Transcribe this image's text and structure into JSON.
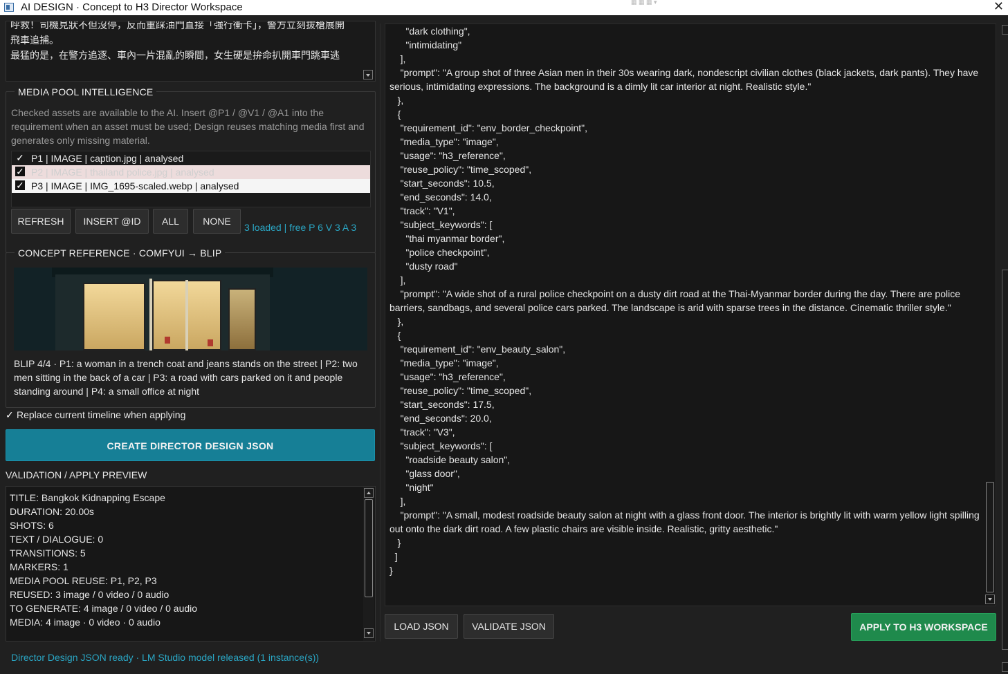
{
  "window": {
    "title": "AI DESIGN · Concept to H3 Director Workspace",
    "close_glyph": "✕"
  },
  "story": {
    "text": "呼救！司機見狀不但沒停，反而重踩油門直接「強行衝卡」，警方立刻拔槍展開\n飛車追捕。\n最猛的是，在警方追逐、車內一片混亂的瞬間，女生硬是拚命扒開車門跳車逃"
  },
  "media_pool": {
    "title": "MEDIA POOL INTELLIGENCE",
    "description": "Checked assets are available to the AI. Insert @P1 / @V1 / @A1 into the requirement when an asset must be used; Design reuses matching media first and generates only missing material.",
    "assets": [
      {
        "check": "✓",
        "label": "P1  |  IMAGE  |  caption.jpg  |  analysed"
      },
      {
        "check": "✓",
        "label": "P2  |  IMAGE  |  thailand police.jpg  |  analysed"
      },
      {
        "check": "✓",
        "label": "P3  |  IMAGE  |  IMG_1695-scaled.webp  |  analysed"
      }
    ],
    "buttons": {
      "refresh": "REFRESH",
      "insert": "INSERT @ID",
      "all": "ALL",
      "none": "NONE"
    },
    "status": "3 loaded  |  free P 6 V 3 A 3"
  },
  "concept": {
    "title": "CONCEPT REFERENCE · COMFYUI → BLIP",
    "caption": "BLIP 4/4 · P1: a woman in a trench coat and jeans stands on the street | P2: two men sitting in the back of a car | P3: a road with cars parked on it and people standing around | P4: a small office at night"
  },
  "options": {
    "replace_tick": "✓",
    "replace_label": "Replace current timeline when applying"
  },
  "actions": {
    "create": "CREATE DIRECTOR DESIGN JSON",
    "load": "LOAD JSON",
    "validate": "VALIDATE JSON",
    "apply": "APPLY TO H3 WORKSPACE"
  },
  "validation": {
    "label": "VALIDATION / APPLY PREVIEW",
    "lines": [
      "TITLE: Bangkok Kidnapping Escape",
      "DURATION: 20.00s",
      "SHOTS: 6",
      "TEXT / DIALOGUE: 0",
      "TRANSITIONS: 5",
      "MARKERS: 1",
      "MEDIA POOL REUSE: P1, P2, P3",
      "REUSED: 3 image / 0 video / 0 audio",
      "TO GENERATE: 4 image / 0 video / 0 audio",
      "MEDIA: 4 image · 0 video · 0 audio"
    ]
  },
  "json_view": {
    "text": "      \"dark clothing\",\n      \"intimidating\"\n    ],\n    \"prompt\": \"A group shot of three Asian men in their 30s wearing dark, nondescript civilian clothes (black jackets, dark pants). They have serious, intimidating expressions. The background is a dimly lit car interior at night. Realistic style.\"\n   },\n   {\n    \"requirement_id\": \"env_border_checkpoint\",\n    \"media_type\": \"image\",\n    \"usage\": \"h3_reference\",\n    \"reuse_policy\": \"time_scoped\",\n    \"start_seconds\": 10.5,\n    \"end_seconds\": 14.0,\n    \"track\": \"V1\",\n    \"subject_keywords\": [\n      \"thai myanmar border\",\n      \"police checkpoint\",\n      \"dusty road\"\n    ],\n    \"prompt\": \"A wide shot of a rural police checkpoint on a dusty dirt road at the Thai-Myanmar border during the day. There are police barriers, sandbags, and several police cars parked. The landscape is arid with sparse trees in the distance. Cinematic thriller style.\"\n   },\n   {\n    \"requirement_id\": \"env_beauty_salon\",\n    \"media_type\": \"image\",\n    \"usage\": \"h3_reference\",\n    \"reuse_policy\": \"time_scoped\",\n    \"start_seconds\": 17.5,\n    \"end_seconds\": 20.0,\n    \"track\": \"V3\",\n    \"subject_keywords\": [\n      \"roadside beauty salon\",\n      \"glass door\",\n      \"night\"\n    ],\n    \"prompt\": \"A small, modest roadside beauty salon at night with a glass front door. The interior is brightly lit with warm yellow light spilling out onto the dark dirt road. A few plastic chairs are visible inside. Realistic, gritty aesthetic.\"\n   }\n  ]\n}"
  },
  "status_bar": {
    "text": "Director Design JSON ready · LM Studio model released (1 instance(s))"
  },
  "colors": {
    "accent_create": "#167f96",
    "accent_apply": "#1f8a4c",
    "status_text": "#2aa6c4",
    "background": "#202020"
  }
}
